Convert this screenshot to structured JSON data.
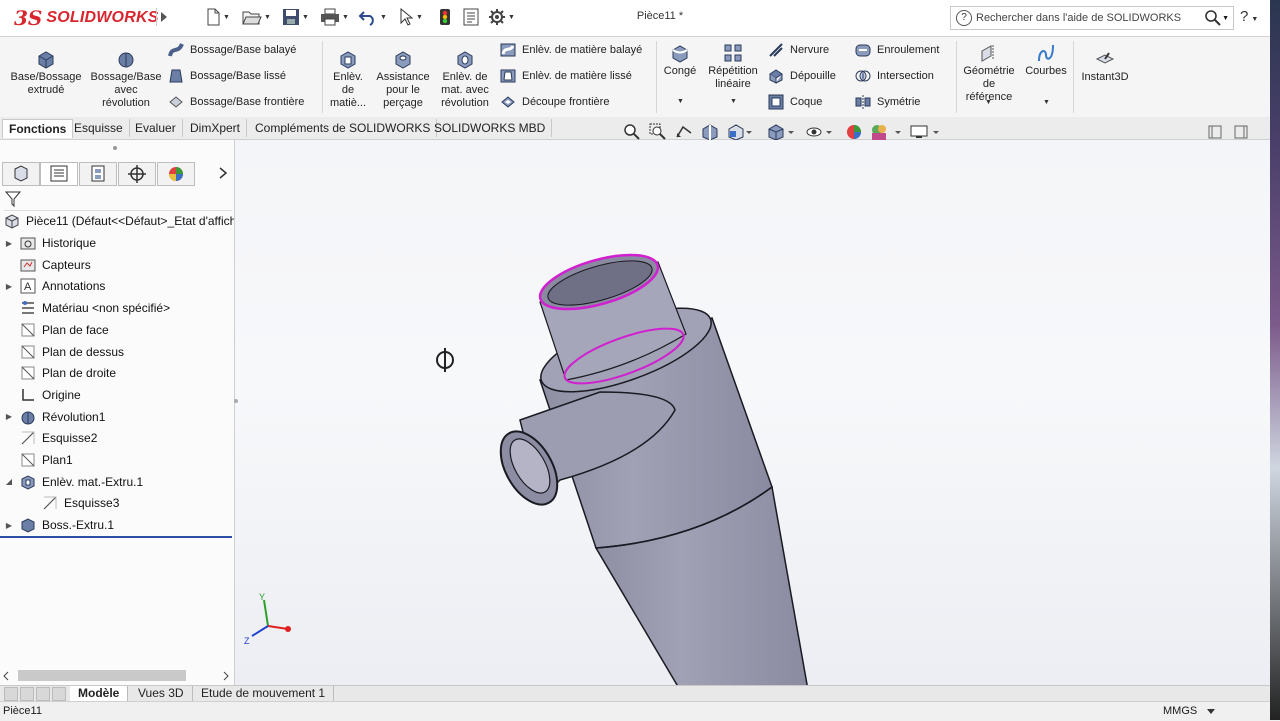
{
  "app": {
    "logo_ds": "3S",
    "logo_text": "SOLIDWORKS",
    "document_title": "Pièce11 *",
    "help_search_placeholder": "Rechercher dans l'aide de SOLIDWORKS",
    "help_label": "?"
  },
  "ribbon": {
    "boss_extrude": [
      "Base/Bossage",
      "extrudé"
    ],
    "boss_revolve": [
      "Bossage/Base",
      "avec",
      "révolution"
    ],
    "boss_swept": "Bossage/Base balayé",
    "boss_loft": "Bossage/Base lissé",
    "boss_boundary": "Bossage/Base frontière",
    "cut_extrude": [
      "Enlèv.",
      "de",
      "matiè..."
    ],
    "hole_wizard": [
      "Assistance",
      "pour le",
      "perçage"
    ],
    "cut_revolve": [
      "Enlèv. de",
      "mat. avec",
      "révolution"
    ],
    "cut_swept": "Enlèv. de matière balayé",
    "cut_loft": "Enlèv. de matière lissé",
    "cut_boundary": "Découpe frontière",
    "fillet": "Congé",
    "linear_pattern": [
      "Répétition",
      "linéaire"
    ],
    "rib": "Nervure",
    "draft": "Dépouille",
    "shell": "Coque",
    "wrap": "Enroulement",
    "intersect": "Intersection",
    "mirror": "Symétrie",
    "ref_geometry": [
      "Géométrie",
      "de",
      "référence"
    ],
    "curves": "Courbes",
    "instant3d": "Instant3D"
  },
  "tabs": [
    "Fonctions",
    "Esquisse",
    "Evaluer",
    "DimXpert",
    "Compléments de SOLIDWORKS",
    "SOLIDWORKS MBD"
  ],
  "tree": {
    "root": "Pièce11  (Défaut<<Défaut>_Etat d'affich",
    "items": [
      {
        "label": "Historique",
        "expandable": true,
        "icon": "history-folder-icon"
      },
      {
        "label": "Capteurs",
        "expandable": false,
        "icon": "sensors-folder-icon"
      },
      {
        "label": "Annotations",
        "expandable": true,
        "icon": "annotations-icon"
      },
      {
        "label": "Matériau <non spécifié>",
        "expandable": false,
        "icon": "material-icon"
      },
      {
        "label": "Plan de face",
        "expandable": false,
        "icon": "plane-icon"
      },
      {
        "label": "Plan de dessus",
        "expandable": false,
        "icon": "plane-icon"
      },
      {
        "label": "Plan de droite",
        "expandable": false,
        "icon": "plane-icon"
      },
      {
        "label": "Origine",
        "expandable": false,
        "icon": "origin-icon"
      },
      {
        "label": "Révolution1",
        "expandable": true,
        "icon": "revolve-feature-icon"
      },
      {
        "label": "Esquisse2",
        "expandable": false,
        "icon": "sketch-icon"
      },
      {
        "label": "Plan1",
        "expandable": false,
        "icon": "plane-icon"
      },
      {
        "label": "Enlèv. mat.-Extru.1",
        "expandable": true,
        "expanded": true,
        "icon": "cut-extrude-feature-icon"
      },
      {
        "label": "Esquisse3",
        "expandable": false,
        "child": true,
        "icon": "sketch-icon"
      },
      {
        "label": "Boss.-Extru.1",
        "expandable": true,
        "icon": "boss-extrude-feature-icon"
      }
    ]
  },
  "bottom_tabs": [
    "Modèle",
    "Vues 3D",
    "Etude de mouvement 1"
  ],
  "status": {
    "left": "Pièce11",
    "units": "MMGS"
  },
  "triad": {
    "x": "X",
    "y": "Y",
    "z": "Z"
  },
  "colors": {
    "accent_red": "#d9262e",
    "part_gray": "#9b9bb0",
    "selection_magenta": "#d020d0",
    "rollback_blue": "#2b4fa3"
  }
}
